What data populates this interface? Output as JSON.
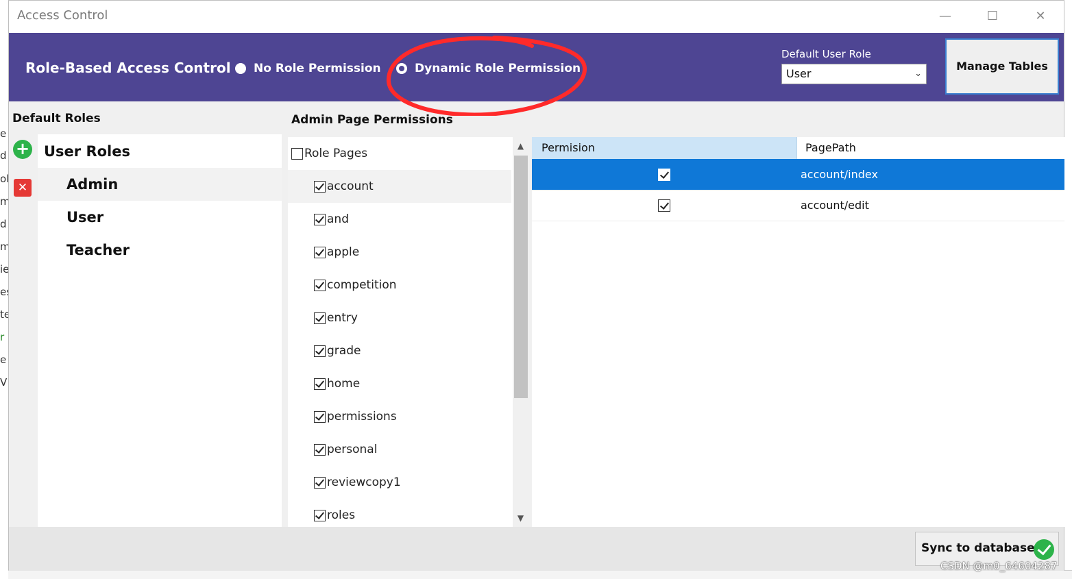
{
  "window": {
    "title": "Access Control",
    "minimize": "—",
    "maximize": "☐",
    "close": "✕"
  },
  "background_fragments": [
    "e",
    "d",
    "ol",
    "m",
    "d",
    "m",
    "ie",
    "es",
    "te",
    "r",
    "e",
    "V"
  ],
  "header": {
    "title": "Role-Based Access Control",
    "radio_options": [
      {
        "label": "No Role Permission",
        "selected": false
      },
      {
        "label": "Dynamic Role Permission",
        "selected": true
      }
    ],
    "default_role_label": "Default User Role",
    "default_role_value": "User",
    "manage_button": "Manage Tables",
    "header_color": "#4e4593",
    "annotation_color": "#ff2a2a"
  },
  "roles": {
    "section_label": "Default Roles",
    "heading": "User Roles",
    "items": [
      "Admin",
      "User",
      "Teacher"
    ],
    "selected": "Admin"
  },
  "pages": {
    "section_label": "Admin Page Permissions",
    "root_label": "Role Pages",
    "items": [
      "account",
      "and",
      "apple",
      "competition",
      "entry",
      "grade",
      "home",
      "permissions",
      "personal",
      "reviewcopy1",
      "roles"
    ],
    "selected": "account"
  },
  "grid": {
    "columns": [
      "Permision",
      "PagePath"
    ],
    "rows": [
      {
        "checked": true,
        "path": "account/index",
        "selected": true
      },
      {
        "checked": true,
        "path": "account/edit",
        "selected": false
      }
    ],
    "selection_color": "#0f78d7"
  },
  "footer": {
    "sync_button": "Sync to database"
  },
  "watermark": "CSDN @m0_64604287"
}
